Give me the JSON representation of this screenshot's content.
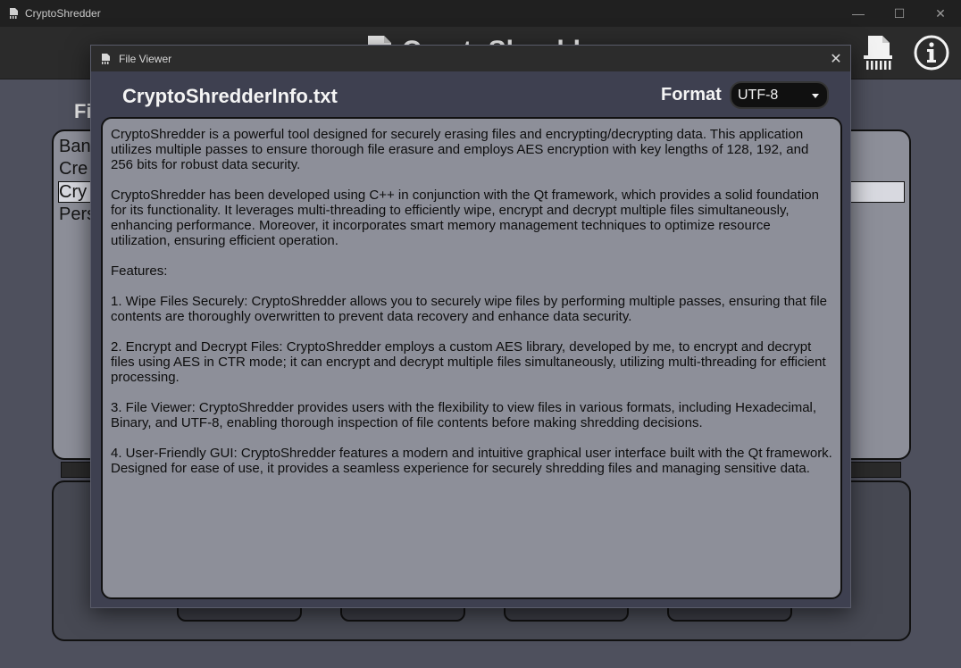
{
  "window": {
    "title": "CryptoShredder",
    "controls": {
      "minimize": "—",
      "maximize": "☐",
      "close": "✕"
    }
  },
  "header": {
    "logo_text": "CryptoShredder",
    "shred_icon": "shredder-icon",
    "info_icon": "info-icon"
  },
  "main": {
    "section_label": "Fi",
    "file_list_items": [
      "Ban",
      "Cre",
      "Cry",
      "Pers"
    ],
    "selected_index": 2
  },
  "dialog": {
    "title": "File Viewer",
    "close_label": "✕",
    "file_name": "CryptoShredderInfo.txt",
    "format_label": "Format",
    "format_value": "UTF-8",
    "content": [
      "CryptoShredder is a powerful tool designed for securely erasing files and encrypting/decrypting data. This application utilizes multiple passes to ensure thorough file erasure and employs AES encryption with key lengths of 128, 192, and 256 bits for robust data security.",
      "CryptoShredder has been developed using C++ in conjunction with the Qt framework, which provides a solid foundation for its functionality. It leverages multi-threading to efficiently wipe, encrypt and decrypt multiple files simultaneously, enhancing performance. Moreover, it incorporates smart memory management techniques to optimize resource utilization, ensuring efficient operation.",
      "Features:",
      "1. Wipe Files Securely: CryptoShredder allows you to securely wipe files by performing multiple passes, ensuring that file contents are thoroughly overwritten to prevent data recovery and enhance data security.",
      "2. Encrypt and Decrypt Files: CryptoShredder employs a custom AES library, developed by me, to encrypt and decrypt files using AES in CTR mode; it can encrypt and decrypt multiple files simultaneously, utilizing multi-threading for efficient processing.",
      "3. File Viewer: CryptoShredder provides users with the flexibility to view files in various formats, including Hexadecimal, Binary, and UTF-8, enabling thorough inspection of file contents before making shredding decisions.",
      "4. User-Friendly GUI: CryptoShredder features a modern and intuitive graphical user interface built with the Qt framework. Designed for ease of use, it provides a seamless experience for securely shredding files and managing sensitive data."
    ]
  },
  "colors": {
    "background": "#4e505d",
    "titlebar": "#202020",
    "panel": "#8d8f99",
    "dialog": "#3e4050"
  }
}
